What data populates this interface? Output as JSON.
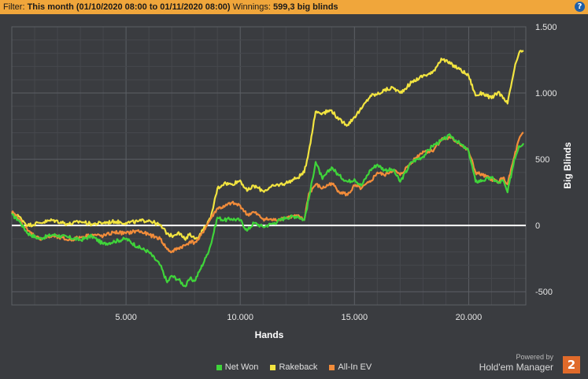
{
  "filter": {
    "label": "Filter:",
    "period": "This month (01/10/2020 08:00 to 01/11/2020 08:00)",
    "winnings_label": "Winnings:",
    "winnings_value": "599,3 big blinds"
  },
  "help_icon": "?",
  "brand": {
    "powered_by": "Powered by",
    "name": "Hold'em Manager",
    "logo": "2"
  },
  "chart_data": {
    "type": "line",
    "xlabel": "Hands",
    "ylabel": "Big Blinds",
    "xlim": [
      0,
      22500
    ],
    "ylim": [
      -600,
      1500
    ],
    "xticks": [
      5000,
      10000,
      15000,
      20000
    ],
    "xtick_labels": [
      "5.000",
      "10.000",
      "15.000",
      "20.000"
    ],
    "yticks": [
      -500,
      0,
      500,
      1000,
      1500
    ],
    "ytick_labels": [
      "-500",
      "0",
      "500",
      "1.000",
      "1.500"
    ],
    "grid": true,
    "legend_position": "bottom-center",
    "zero_line_color": "#ffffff",
    "series": [
      {
        "name": "Net Won",
        "color": "#3fd43a",
        "x": [
          0,
          300,
          700,
          1200,
          1800,
          2500,
          3000,
          3500,
          4000,
          4500,
          5000,
          5500,
          6000,
          6500,
          6800,
          7000,
          7300,
          7600,
          7800,
          8000,
          8200,
          8500,
          8700,
          9000,
          9300,
          9600,
          10000,
          10300,
          10600,
          11000,
          11500,
          12000,
          12500,
          12800,
          13000,
          13300,
          13600,
          14000,
          14300,
          14700,
          15000,
          15300,
          15700,
          16000,
          16300,
          16700,
          17000,
          17500,
          18000,
          18400,
          18800,
          19200,
          19600,
          20000,
          20300,
          20600,
          21000,
          21300,
          21500,
          21700,
          22000,
          22200,
          22400
        ],
        "y": [
          80,
          40,
          -60,
          -100,
          -70,
          -90,
          -110,
          -80,
          -140,
          -120,
          -100,
          -160,
          -200,
          -300,
          -430,
          -380,
          -410,
          -460,
          -400,
          -420,
          -350,
          -240,
          -150,
          60,
          40,
          50,
          40,
          -40,
          20,
          -10,
          20,
          60,
          70,
          40,
          200,
          480,
          350,
          440,
          380,
          330,
          350,
          300,
          420,
          460,
          420,
          420,
          330,
          480,
          520,
          600,
          640,
          680,
          620,
          560,
          330,
          340,
          360,
          320,
          340,
          250,
          500,
          600,
          620
        ]
      },
      {
        "name": "Rakeback",
        "color": "#f2e440",
        "x": [
          0,
          300,
          700,
          1200,
          1800,
          2500,
          3000,
          3500,
          4000,
          4500,
          5000,
          5500,
          6000,
          6500,
          6800,
          7000,
          7300,
          7600,
          7800,
          8000,
          8200,
          8500,
          8700,
          9000,
          9300,
          9600,
          10000,
          10300,
          10600,
          11000,
          11500,
          12000,
          12500,
          12800,
          13000,
          13300,
          13600,
          14000,
          14300,
          14700,
          15000,
          15300,
          15700,
          16000,
          16300,
          16700,
          17000,
          17500,
          18000,
          18400,
          18800,
          19200,
          19600,
          20000,
          20300,
          20600,
          21000,
          21300,
          21500,
          21700,
          22000,
          22200,
          22400
        ],
        "y": [
          90,
          70,
          0,
          20,
          40,
          10,
          30,
          10,
          20,
          30,
          20,
          30,
          40,
          0,
          -60,
          -80,
          -50,
          -110,
          -60,
          -100,
          -80,
          0,
          50,
          280,
          320,
          310,
          340,
          260,
          300,
          260,
          300,
          320,
          360,
          400,
          560,
          860,
          850,
          870,
          800,
          760,
          820,
          880,
          980,
          990,
          1020,
          1040,
          1000,
          1080,
          1130,
          1150,
          1260,
          1220,
          1180,
          1130,
          980,
          1000,
          960,
          1010,
          960,
          920,
          1180,
          1300,
          1320
        ]
      },
      {
        "name": "All-In EV",
        "color": "#f28c3a",
        "x": [
          0,
          300,
          700,
          1200,
          1800,
          2500,
          3000,
          3500,
          4000,
          4500,
          5000,
          5500,
          6000,
          6500,
          6800,
          7000,
          7300,
          7600,
          7800,
          8000,
          8200,
          8500,
          8700,
          9000,
          9300,
          9600,
          10000,
          10300,
          10600,
          11000,
          11500,
          12000,
          12500,
          12800,
          13000,
          13300,
          13600,
          14000,
          14300,
          14700,
          15000,
          15300,
          15700,
          16000,
          16300,
          16700,
          17000,
          17500,
          18000,
          18400,
          18800,
          19200,
          19600,
          20000,
          20300,
          20600,
          21000,
          21300,
          21500,
          21700,
          22000,
          22200,
          22400
        ],
        "y": [
          100,
          50,
          -40,
          -100,
          -80,
          -110,
          -90,
          -70,
          -80,
          -50,
          -60,
          -40,
          -70,
          -100,
          -180,
          -200,
          -170,
          -150,
          -120,
          -130,
          -100,
          -10,
          50,
          130,
          140,
          170,
          150,
          80,
          100,
          50,
          40,
          60,
          70,
          40,
          240,
          310,
          280,
          320,
          260,
          230,
          300,
          280,
          330,
          400,
          380,
          420,
          380,
          480,
          560,
          560,
          650,
          660,
          620,
          560,
          400,
          380,
          350,
          330,
          360,
          310,
          520,
          650,
          700
        ]
      }
    ]
  }
}
